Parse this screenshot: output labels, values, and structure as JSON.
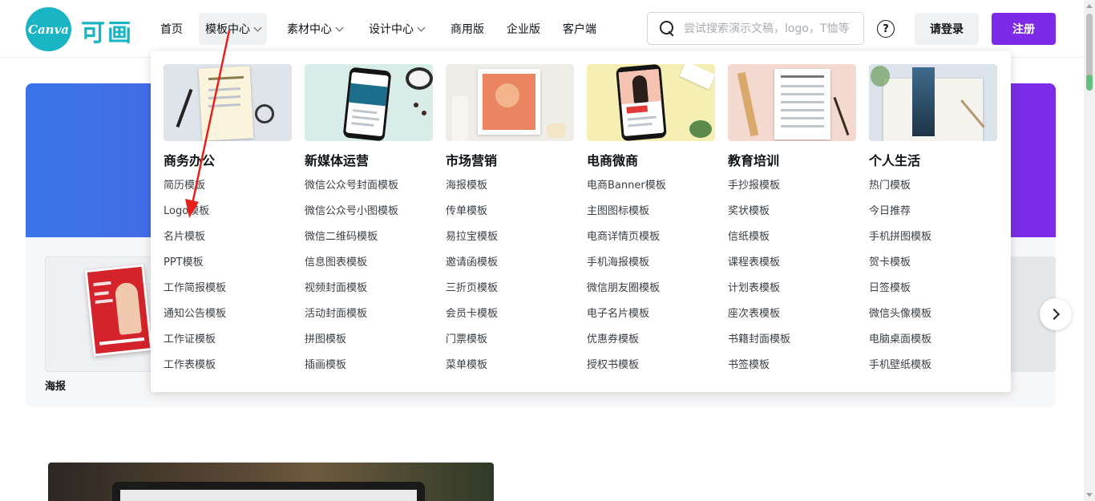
{
  "header": {
    "logo_text": "Canva",
    "logo_cn": "可画",
    "nav": [
      {
        "label": "首页"
      },
      {
        "label": "模板中心"
      },
      {
        "label": "素材中心"
      },
      {
        "label": "设计中心"
      },
      {
        "label": "商用版"
      },
      {
        "label": "企业版"
      },
      {
        "label": "客户端"
      }
    ],
    "search_placeholder": "尝试搜索演示文稿，logo，T恤等",
    "help_label": "?",
    "login_label": "请登录",
    "register_label": "注册"
  },
  "page": {
    "poster_caption": "海报"
  },
  "mega_menu": {
    "columns": [
      {
        "title": "商务办公",
        "links": [
          "简历模板",
          "Logo模板",
          "名片模板",
          "PPT模板",
          "工作简报模板",
          "通知公告模板",
          "工作证模板",
          "工作表模板"
        ]
      },
      {
        "title": "新媒体运营",
        "links": [
          "微信公众号封面模板",
          "微信公众号小图模板",
          "微信二维码模板",
          "信息图表模板",
          "视频封面模板",
          "活动封面模板",
          "拼图模板",
          "插画模板"
        ]
      },
      {
        "title": "市场营销",
        "links": [
          "海报模板",
          "传单模板",
          "易拉宝模板",
          "邀请函模板",
          "三折页模板",
          "会员卡模板",
          "门票模板",
          "菜单模板"
        ]
      },
      {
        "title": "电商微商",
        "links": [
          "电商Banner模板",
          "主图图标模板",
          "电商详情页模板",
          "手机海报模板",
          "微信朋友圈模板",
          "电子名片模板",
          "优惠券模板",
          "授权书模板"
        ]
      },
      {
        "title": "教育培训",
        "links": [
          "手抄报模板",
          "奖状模板",
          "信纸模板",
          "课程表模板",
          "计划表模板",
          "座次表模板",
          "书籍封面模板",
          "书签模板"
        ]
      },
      {
        "title": "个人生活",
        "links": [
          "热门模板",
          "今日推荐",
          "手机拼图模板",
          "贺卡模板",
          "日签模板",
          "微信头像模板",
          "电脑桌面模板",
          "手机壁纸模板"
        ]
      }
    ]
  },
  "colors": {
    "brand_purple": "#7d2ae8",
    "brand_teal": "#1ab5c5",
    "annotation_red": "#e8201c"
  }
}
